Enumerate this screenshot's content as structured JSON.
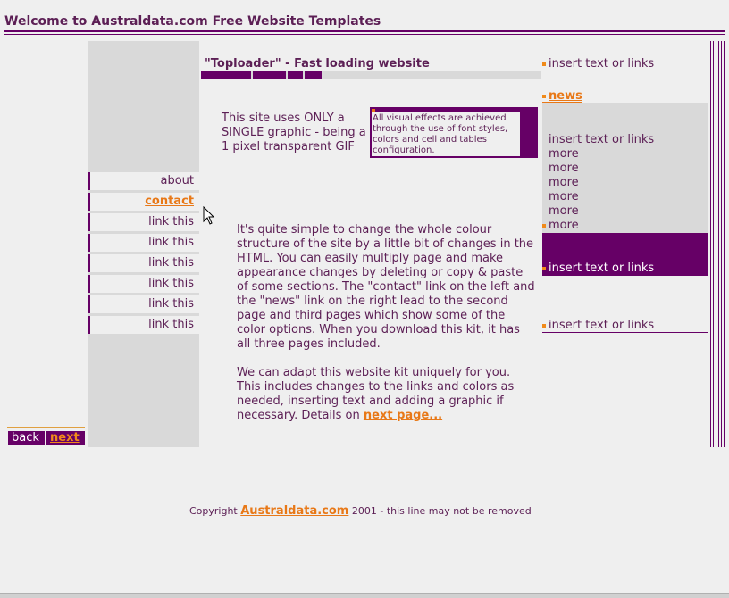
{
  "header": {
    "site_title": "Welcome to Australdata.com Free Website Templates"
  },
  "left_nav": {
    "items": [
      {
        "label": "about"
      },
      {
        "label": "contact",
        "active": true
      },
      {
        "label": "link this"
      },
      {
        "label": "link this"
      },
      {
        "label": "link this"
      },
      {
        "label": "link this"
      },
      {
        "label": "link this"
      },
      {
        "label": "link this"
      }
    ],
    "back_label": "back",
    "next_label": "next"
  },
  "main": {
    "heading": "\"Toploader\" - Fast loading website",
    "intro": "This site uses ONLY a SINGLE graphic - being a 1 pixel transparent GIF",
    "callout": "All visual effects are achieved through the use of font styles, colors and cell and tables configuration.",
    "paragraph1": "It's quite simple to change the whole colour structure of the site by a little bit of changes in the HTML. You can easily multiply page and make appearance changes by deleting or copy & paste of some sections. The \"contact\" link on the left and the \"news\" link on the right lead to the second page and third pages which show some of the color options. When you download this kit, it has all three pages included.",
    "paragraph2": "We can adapt this website kit uniquely for you. This includes changes to the links and colors as needed, inserting text and adding a graphic if necessary. Details on",
    "next_page_link": "next page..."
  },
  "right_col": {
    "top_link": "insert text or links",
    "news_title": "news",
    "news_link": "insert text or links",
    "more_items": [
      "more",
      "more",
      "more",
      "more",
      "more",
      "more"
    ],
    "purple_link": "insert text or links",
    "bottom_link": "insert text or links"
  },
  "footer": {
    "prefix": "Copyright",
    "brand": "Australdata.com",
    "suffix": "2001 - this line may not be removed"
  },
  "colors": {
    "primary": "#660066",
    "accent": "#e87817",
    "background": "#efefef",
    "panel": "#d9d9d9"
  }
}
